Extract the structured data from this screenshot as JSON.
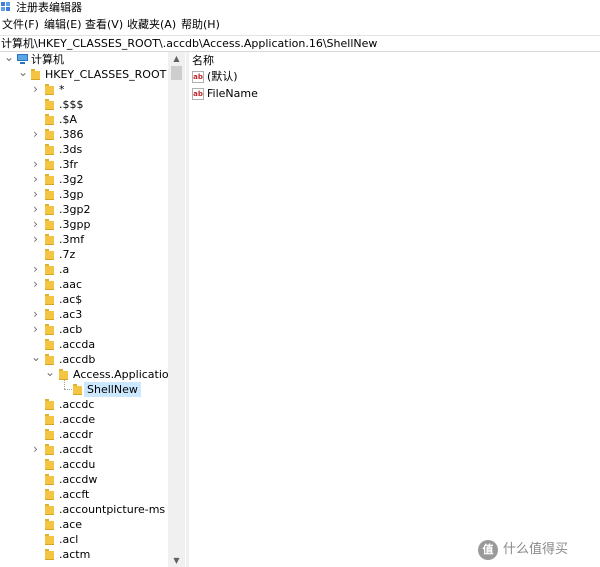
{
  "window": {
    "title": "注册表编辑器"
  },
  "menu": [
    "文件(F)",
    "编辑(E)",
    "查看(V)",
    "收藏夹(A)",
    "帮助(H)"
  ],
  "address": "计算机\\HKEY_CLASSES_ROOT\\.accdb\\Access.Application.16\\ShellNew",
  "tree": {
    "root": "计算机",
    "hive": "HKEY_CLASSES_ROOT",
    "keys": [
      {
        "label": "*",
        "expander": "collapsed"
      },
      {
        "label": ".$$$",
        "expander": "none"
      },
      {
        "label": ".$A",
        "expander": "none"
      },
      {
        "label": ".386",
        "expander": "collapsed"
      },
      {
        "label": ".3ds",
        "expander": "none"
      },
      {
        "label": ".3fr",
        "expander": "collapsed"
      },
      {
        "label": ".3g2",
        "expander": "collapsed"
      },
      {
        "label": ".3gp",
        "expander": "collapsed"
      },
      {
        "label": ".3gp2",
        "expander": "collapsed"
      },
      {
        "label": ".3gpp",
        "expander": "collapsed"
      },
      {
        "label": ".3mf",
        "expander": "collapsed"
      },
      {
        "label": ".7z",
        "expander": "none"
      },
      {
        "label": ".a",
        "expander": "collapsed"
      },
      {
        "label": ".aac",
        "expander": "collapsed"
      },
      {
        "label": ".ac$",
        "expander": "none"
      },
      {
        "label": ".ac3",
        "expander": "collapsed"
      },
      {
        "label": ".acb",
        "expander": "collapsed"
      },
      {
        "label": ".accda",
        "expander": "none"
      },
      {
        "label": ".accdb",
        "expander": "expanded"
      },
      {
        "label": ".accdc",
        "expander": "none"
      },
      {
        "label": ".accde",
        "expander": "none"
      },
      {
        "label": ".accdr",
        "expander": "none"
      },
      {
        "label": ".accdt",
        "expander": "collapsed"
      },
      {
        "label": ".accdu",
        "expander": "none"
      },
      {
        "label": ".accdw",
        "expander": "none"
      },
      {
        "label": ".accft",
        "expander": "none"
      },
      {
        "label": ".accountpicture-ms",
        "expander": "none"
      },
      {
        "label": ".ace",
        "expander": "none"
      },
      {
        "label": ".acl",
        "expander": "none"
      },
      {
        "label": ".actm",
        "expander": "none"
      }
    ],
    "expanded_child": "Access.Application.",
    "selected_key": "ShellNew"
  },
  "values": {
    "header": "名称",
    "rows": [
      {
        "name": "(默认)",
        "icon": "string-value-icon"
      },
      {
        "name": "FileName",
        "icon": "string-value-icon"
      }
    ]
  },
  "icon_text": "ab",
  "watermark": {
    "logo": "值",
    "text": "什么值得买"
  },
  "colors": {
    "selection": "#cce8ff",
    "folder": "#f4c542",
    "value_icon": "#c0282c"
  }
}
